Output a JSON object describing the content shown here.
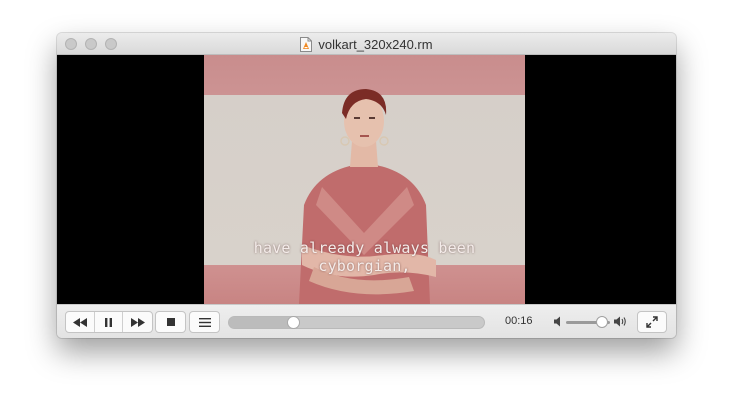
{
  "window": {
    "title": "volkart_320x240.rm"
  },
  "video": {
    "subtitle": "have already always been cyborgian,"
  },
  "controls": {
    "rewind_icon": "rewind-icon",
    "pause_icon": "pause-icon",
    "fast_forward_icon": "fast-forward-icon",
    "stop_icon": "stop-icon",
    "playlist_icon": "playlist-icon",
    "fullscreen_icon": "fullscreen-icon",
    "time": "00:16",
    "seek_progress": 0.25,
    "volume_level": 0.82
  }
}
